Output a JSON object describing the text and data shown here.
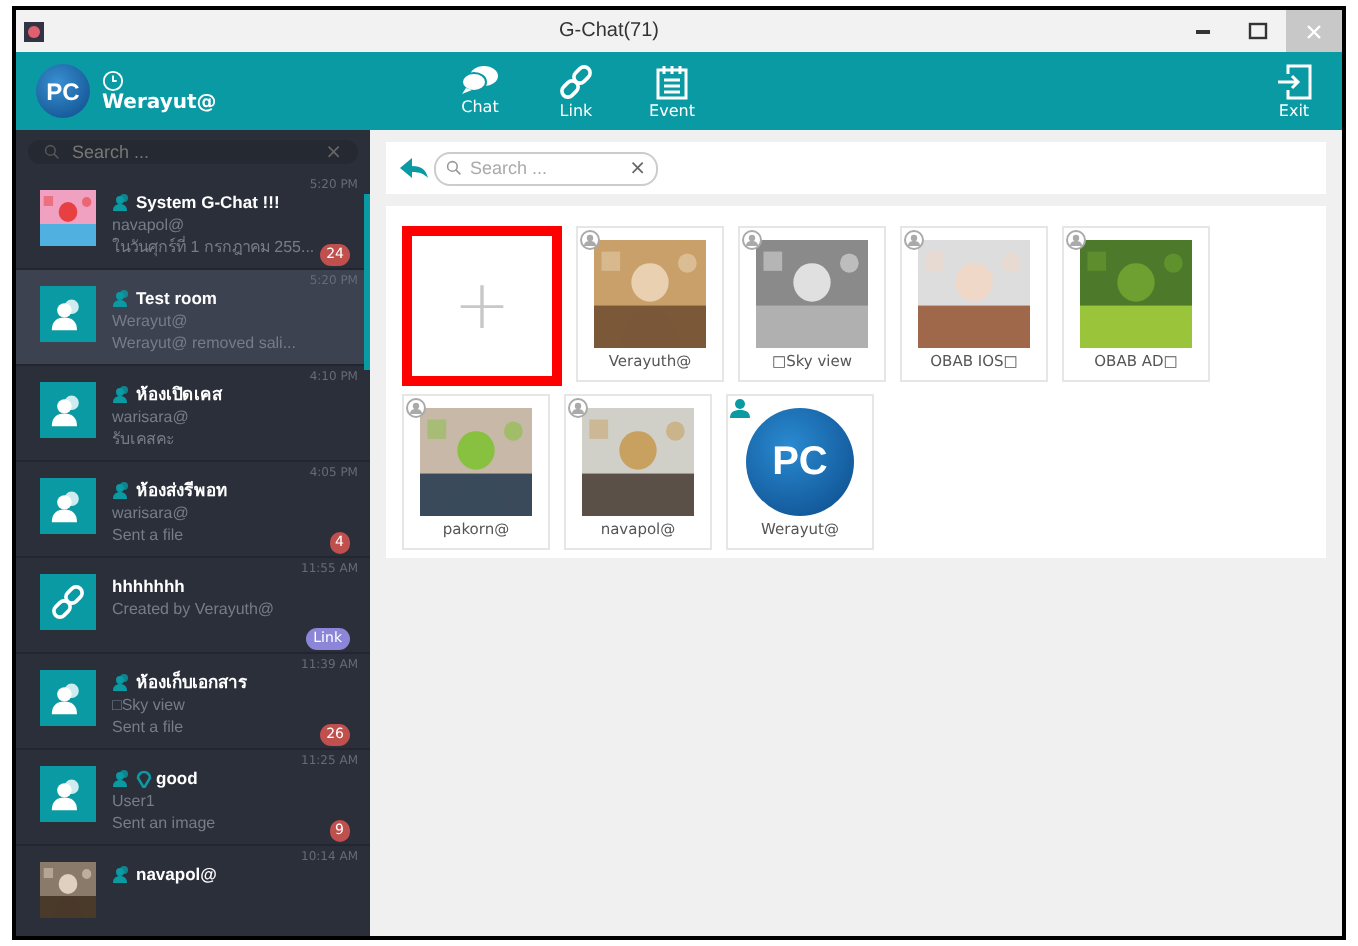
{
  "window": {
    "title": "G-Chat(71)"
  },
  "header": {
    "logo": "PC",
    "user": "Werayut@",
    "nav": [
      {
        "label": "Chat",
        "kind": "chat"
      },
      {
        "label": "Link",
        "kind": "link"
      },
      {
        "label": "Event",
        "kind": "event"
      }
    ],
    "exit": "Exit"
  },
  "sidebar": {
    "search": {
      "placeholder": "Search ..."
    },
    "clear": "×",
    "chats": [
      {
        "kind": "picture",
        "group": true,
        "pin": false,
        "name": "System G-Chat !!!",
        "sender": "navapol@",
        "message": "ในวันศุกร์ที่ 1 กรกฎาคม 255...",
        "time": "5:20 PM",
        "unread": "24",
        "selected": false
      },
      {
        "kind": "group",
        "group": true,
        "pin": false,
        "name": "Test room",
        "sender": "Werayut@",
        "message": "Werayut@ removed sali...",
        "time": "5:20 PM",
        "selected": true
      },
      {
        "kind": "group",
        "group": true,
        "pin": false,
        "name": "ห้องเปิดเคส",
        "sender": "warisara@",
        "message": "รับเคสคะ",
        "time": "4:10 PM",
        "selected": false
      },
      {
        "kind": "group",
        "group": true,
        "pin": false,
        "name": "ห้องส่งรีพอท",
        "sender": "warisara@",
        "message": "Sent a file",
        "time": "4:05 PM",
        "unread": "4",
        "selected": false
      },
      {
        "kind": "link",
        "group": false,
        "pin": false,
        "name": "hhhhhhh",
        "sender": "Created by Verayuth@",
        "time": "11:55 AM",
        "tag": "Link",
        "selected": false
      },
      {
        "kind": "group",
        "group": true,
        "pin": false,
        "name": "ห้องเก็บเอกสาร",
        "sender": "□Sky view",
        "message": "Sent a file",
        "time": "11:39 AM",
        "unread": "26",
        "selected": false
      },
      {
        "kind": "group",
        "group": true,
        "pin": true,
        "name": "good",
        "sender": "User1",
        "message": "Sent an image",
        "time": "11:25 AM",
        "unread": "9",
        "selected": false
      },
      {
        "kind": "picture",
        "group": true,
        "pin": false,
        "name": "navapol@",
        "time": "10:14 AM",
        "selected": false
      }
    ]
  },
  "content": {
    "search": {
      "placeholder": "Search ..."
    },
    "clear": "×",
    "add_tile": {
      "label": "+"
    },
    "members": [
      {
        "name": "Verayuth@",
        "online": false,
        "kind": "picture"
      },
      {
        "name": "□Sky view",
        "online": false,
        "kind": "picture"
      },
      {
        "name": "OBAB IOS□",
        "online": false,
        "kind": "picture"
      },
      {
        "name": "OBAB AD□",
        "online": false,
        "kind": "picture"
      },
      {
        "name": "pakorn@",
        "online": false,
        "kind": "picture"
      },
      {
        "name": "navapol@",
        "online": false,
        "kind": "picture"
      },
      {
        "name": "Werayut@",
        "online": true,
        "kind": "logo",
        "logo": "PC"
      }
    ]
  }
}
